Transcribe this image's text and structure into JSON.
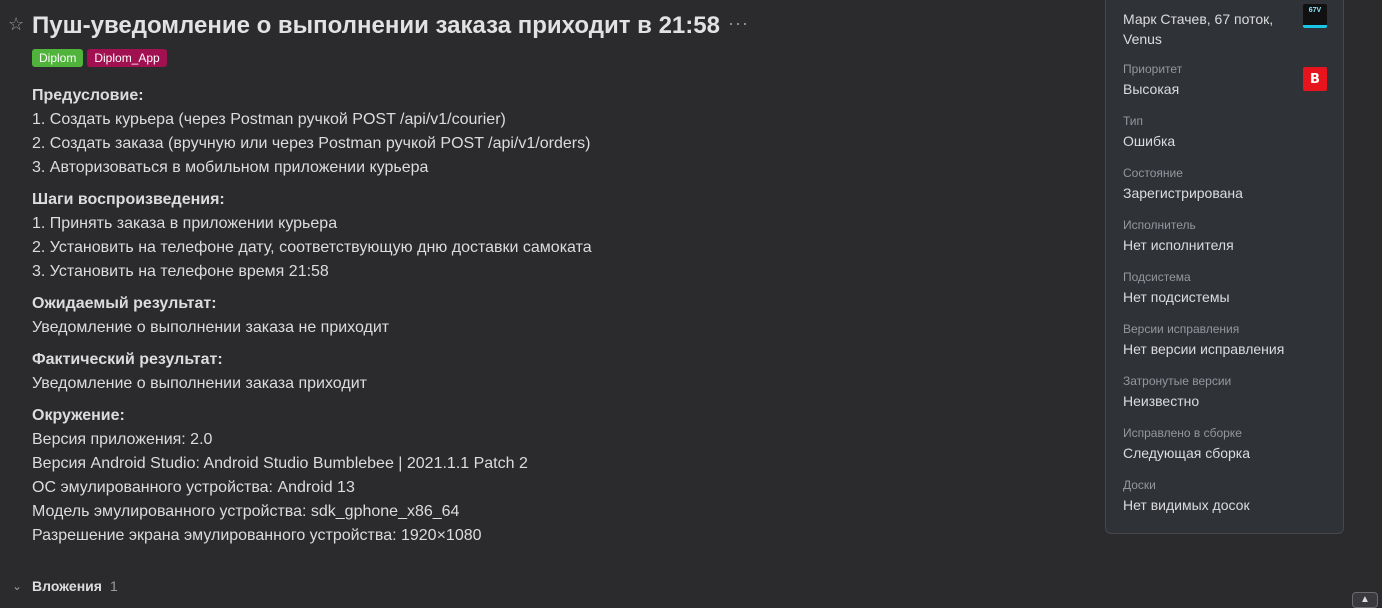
{
  "issue": {
    "title": "Пуш-уведомление о выполнении заказа приходит в 21:58",
    "star_icon": "star-icon",
    "more_label": "···",
    "tags": [
      {
        "label": "Diplom",
        "color": "#4fb33c"
      },
      {
        "label": "Diplom_App",
        "color": "#a11050"
      }
    ]
  },
  "description": {
    "sections": [
      {
        "heading": "Предусловие:",
        "lines": [
          "1. Создать курьера (через Postman ручкой POST /api/v1/courier)",
          "2. Создать заказа (вручную или через Postman ручкой POST /api/v1/orders)",
          "3. Авторизоваться в мобильном приложении курьера"
        ]
      },
      {
        "heading": "Шаги воспроизведения:",
        "lines": [
          "1. Принять заказа в приложении курьера",
          "2. Установить на телефоне дату, соответствующую дню доставки самоката",
          "3. Установить на телефоне время 21:58"
        ]
      },
      {
        "heading": "Ожидаемый результат:",
        "lines": [
          "Уведомление о выполнении заказа не приходит"
        ]
      },
      {
        "heading": "Фактический результат:",
        "lines": [
          "Уведомление о выполнении заказа приходит"
        ]
      },
      {
        "heading": "Окружение:",
        "lines": [
          "Версия приложения: 2.0",
          "Версия Android Studio: Android Studio Bumblebee | 2021.1.1 Patch 2",
          "ОС эмулированного устройства: Android 13",
          "Модель эмулированного устройства: sdk_gphone_x86_64",
          "Разрешение экрана эмулированного устройства: 1920×1080"
        ]
      }
    ]
  },
  "attachments": {
    "label": "Вложения",
    "count": "1"
  },
  "sidebar": {
    "reporter": {
      "value": "Марк Стачев, 67 поток, Venus",
      "avatar_text": "67V"
    },
    "fields": [
      {
        "label": "Приоритет",
        "value": "Высокая"
      },
      {
        "label": "Тип",
        "value": "Ошибка"
      },
      {
        "label": "Состояние",
        "value": "Зарегистрирована"
      },
      {
        "label": "Исполнитель",
        "value": "Нет исполнителя"
      },
      {
        "label": "Подсистема",
        "value": "Нет подсистемы"
      },
      {
        "label": "Версии исправления",
        "value": "Нет версии исправления"
      },
      {
        "label": "Затронутые версии",
        "value": "Неизвестно"
      },
      {
        "label": "Исправлено в сборке",
        "value": "Следующая сборка"
      },
      {
        "label": "Доски",
        "value": "Нет видимых досок"
      }
    ],
    "priority_badge": "В"
  },
  "colors": {
    "background": "#2b2b2e",
    "panel": "#2f3237",
    "priority_badge": "#e8141d"
  }
}
